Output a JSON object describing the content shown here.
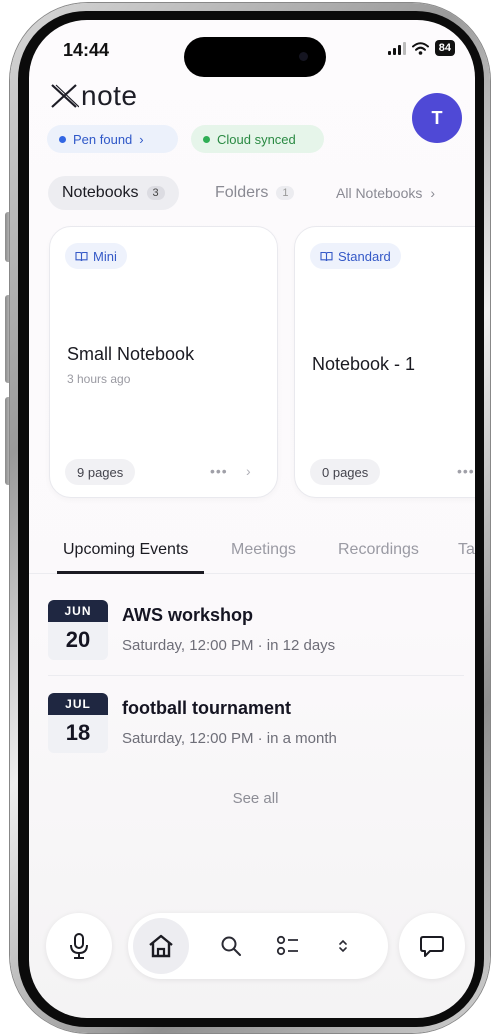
{
  "status_bar": {
    "time": "14:44",
    "battery": "84"
  },
  "header": {
    "app_name": "note",
    "avatar_initial": "T",
    "chips": {
      "pen": "Pen found",
      "pen_chevron": "›",
      "cloud": "Cloud synced"
    }
  },
  "notebook_tabs": {
    "notebooks_label": "Notebooks",
    "notebooks_count": "3",
    "folders_label": "Folders",
    "folders_count": "1",
    "all_label": "All Notebooks",
    "all_chevron": "›"
  },
  "notebooks": [
    {
      "tag": "Mini",
      "title": "Small Notebook",
      "subtitle": "3 hours ago",
      "pages": "9 pages",
      "more": "•••",
      "chevron": "›"
    },
    {
      "tag": "Standard",
      "title": "Notebook - 1",
      "pages": "0 pages",
      "more": "•••"
    }
  ],
  "event_tabs": {
    "upcoming": "Upcoming Events",
    "meetings": "Meetings",
    "recordings": "Recordings",
    "tasks": "Tas"
  },
  "events": [
    {
      "month": "JUN",
      "day": "20",
      "title": "AWS workshop",
      "meta": "Saturday, 12:00 PM · in 12 days"
    },
    {
      "month": "JUL",
      "day": "18",
      "title": "football tournament",
      "meta": "Saturday, 12:00 PM · in a month"
    }
  ],
  "see_all": "See all",
  "colors": {
    "accent": "#4f49d6",
    "pen_chip": "#2f58c8",
    "cloud_chip": "#2a8a43",
    "date_header": "#1f2741"
  },
  "icons": {
    "mic": "mic-icon",
    "home": "home-icon",
    "search": "search-icon",
    "tasks": "checklist-icon",
    "expand": "chevron-up-down-icon",
    "chat": "chat-bubble-icon",
    "book": "book-icon"
  }
}
